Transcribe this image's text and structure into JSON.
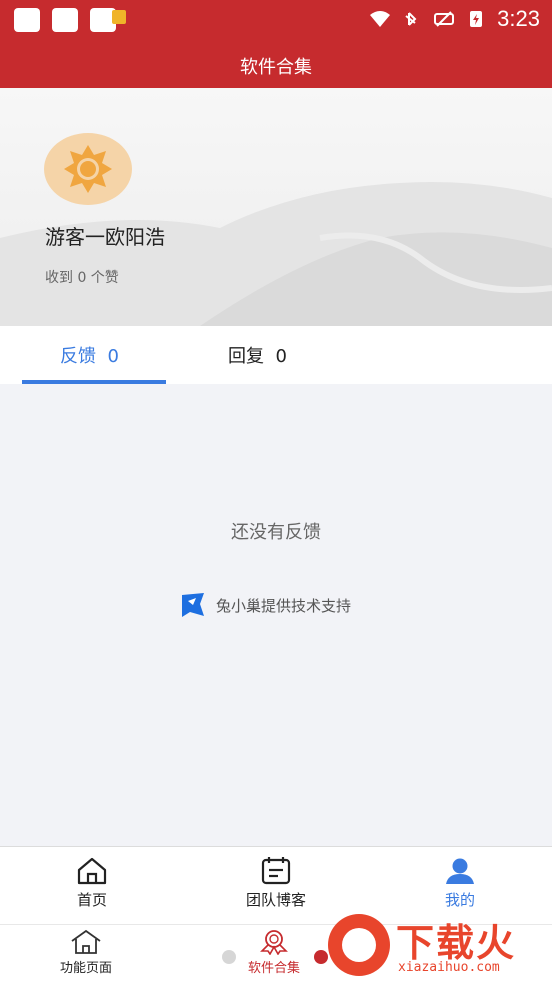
{
  "status_bar": {
    "time": "3:23",
    "icons": [
      "notification-icon",
      "wifi-icon",
      "bluetooth-icon",
      "signal-icon",
      "battery-icon"
    ]
  },
  "title_bar": {
    "title": "软件合集"
  },
  "profile": {
    "avatar_icon": "sun-icon",
    "username": "游客一欧阳浩",
    "likes": "收到 0 个赞"
  },
  "tabs": [
    {
      "label": "反馈",
      "count": "0",
      "active": true
    },
    {
      "label": "回复",
      "count": "0",
      "active": false
    }
  ],
  "empty_state": {
    "message": "还没有反馈"
  },
  "support": {
    "text": "兔小巢提供技术支持",
    "icon": "tuxiaochao-logo-icon"
  },
  "tab_bar": [
    {
      "label": "首页",
      "icon": "home-icon",
      "active": false
    },
    {
      "label": "团队博客",
      "icon": "calendar-icon",
      "active": false
    },
    {
      "label": "我的",
      "icon": "user-icon",
      "active": true
    }
  ],
  "bottom_nav": [
    {
      "label": "功能页面",
      "icon": "home-outline-icon"
    },
    {
      "label": "软件合集",
      "icon": "award-icon"
    }
  ],
  "watermark": {
    "title": "下载火",
    "domain": "xiazaihuo.com"
  },
  "colors": {
    "brand_red": "#c62b2e",
    "accent_blue": "#3a7be0",
    "avatar_bg": "#f5d4a8",
    "sun_orange": "#f0a640"
  }
}
